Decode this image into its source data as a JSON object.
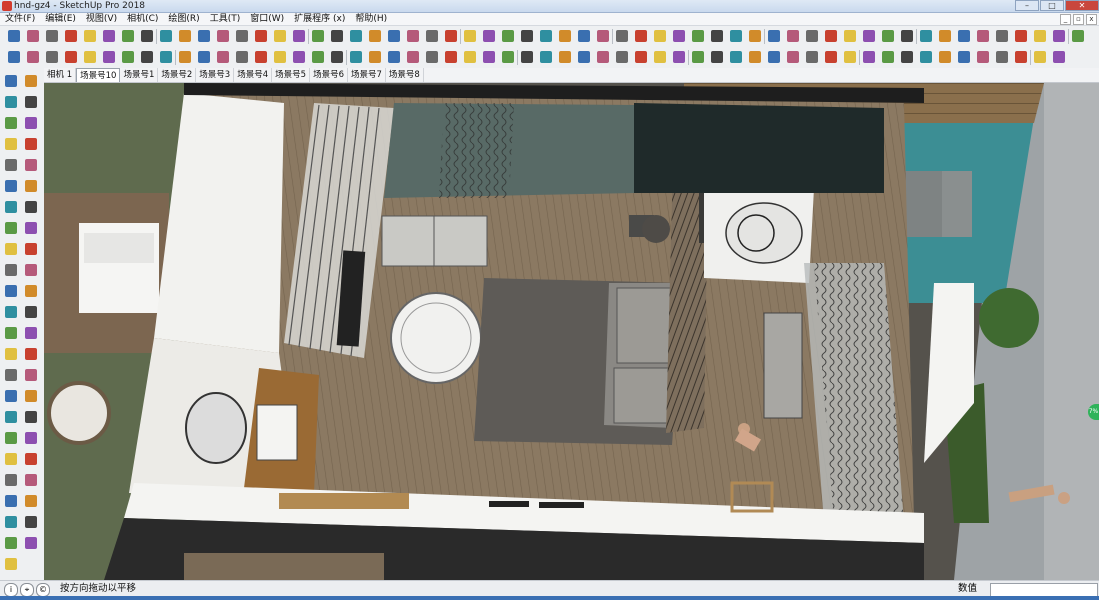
{
  "window": {
    "title": "hnd-gz4 - SketchUp Pro 2018",
    "minimize": "–",
    "maximize": "□",
    "close": "✕"
  },
  "menu": {
    "items": [
      "文件(F)",
      "编辑(E)",
      "视图(V)",
      "相机(C)",
      "绘图(R)",
      "工具(T)",
      "窗口(W)",
      "扩展程序 (x)",
      "帮助(H)"
    ]
  },
  "scenes": {
    "tabs": [
      "相机 1",
      "场景号10",
      "场景号1",
      "场景号2",
      "场景号3",
      "场景号4",
      "场景号5",
      "场景号6",
      "场景号7",
      "场景号8"
    ],
    "active_index": 1
  },
  "statusbar": {
    "message": "按方向拖动以平移",
    "value_label": "数值",
    "value": ""
  },
  "badge": {
    "text": "7%"
  },
  "icons": {
    "toolbar_row1": [
      "select-icon",
      "eraser-icon",
      "line-icon",
      "arc-icon",
      "shape-icon",
      "push-pull-icon",
      "move-icon",
      "rotate-icon",
      "scale-icon",
      "offset-icon",
      "tape-measure-icon",
      "text-icon",
      "axes-icon",
      "paint-bucket-icon",
      "orbit-icon",
      "pan-icon",
      "zoom-icon",
      "zoom-extents-icon",
      "component-icon",
      "warehouse-icon",
      "ruby-icon",
      "isometric-icon",
      "top-view-icon",
      "front-view-icon",
      "right-view-icon",
      "back-view-icon",
      "left-view-icon",
      "xray-icon",
      "wireframe-icon",
      "hidden-line-icon",
      "shaded-icon",
      "textured-icon",
      "monochrome-icon",
      "follow-me-icon",
      "section-icon",
      "dimension-icon",
      "protractor-icon",
      "3d-text-icon",
      "position-camera-icon",
      "walk-icon",
      "look-around-icon",
      "sandbox-icon",
      "shadow-icon",
      "fog-icon",
      "match-photo-icon",
      "home-icon",
      "house-icon",
      "layers-icon",
      "styles-icon",
      "geo-icon",
      "materials-icon",
      "outliner-icon",
      "scene-icon",
      "entity-info-icon",
      "soften-icon",
      "settings-icon",
      "help-icon"
    ],
    "toolbar_row2": [
      "select-icon",
      "pencil-icon",
      "arc-icon",
      "freehand-icon",
      "rectangle-icon",
      "circle-icon",
      "polygon-icon",
      "pie-icon",
      "offset-icon",
      "follow-me-icon",
      "intersect-icon",
      "union-icon",
      "subtract-icon",
      "trim-icon",
      "split-icon",
      "outer-shell-icon",
      "flip-icon",
      "mirror-icon",
      "array-icon",
      "align-icon",
      "weld-icon",
      "chamfer-icon",
      "fillet-icon",
      "extrude-icon",
      "loft-icon",
      "sweep-icon",
      "curve-icon",
      "drape-icon",
      "stamp-icon",
      "smoove-icon",
      "add-detail-icon",
      "flip-edge-icon",
      "contours-icon",
      "from-scratch-icon",
      "terrain-icon",
      "door-icon",
      "window-icon",
      "stair-icon",
      "roof-icon",
      "wall-icon",
      "column-icon",
      "beam-icon",
      "slab-icon",
      "railing-icon",
      "furniture-icon",
      "lamp-icon",
      "plant-icon",
      "people-icon",
      "car-icon",
      "grass-icon",
      "stacked-icon",
      "export-icon",
      "render-icon",
      "light-icon",
      "camera-icon",
      "close-icon"
    ],
    "left_toolbar": [
      "select-icon",
      "make-component-icon",
      "paint-icon",
      "eraser-icon",
      "rectangle-icon",
      "line-icon",
      "circle-icon",
      "arc-icon",
      "polygon-icon",
      "freehand-icon",
      "move-icon",
      "push-pull-icon",
      "rotate-icon",
      "follow-me-icon",
      "scale-icon",
      "offset-icon",
      "tape-icon",
      "dimension-icon",
      "protractor-icon",
      "text-icon",
      "axes-icon",
      "3d-text-icon",
      "orbit-icon",
      "pan-icon",
      "zoom-icon",
      "zoom-window-icon",
      "previous-view-icon",
      "position-camera-icon",
      "walk-icon",
      "look-around-icon",
      "section-icon",
      "sandbox-icon",
      "outliner-icon",
      "styles-icon",
      "materials-icon",
      "layers-icon",
      "scene-icon",
      "shadows-icon",
      "fog-icon",
      "soften-icon",
      "geo-location-icon",
      "warehouse-icon",
      "extension-icon",
      "ruby-console-icon",
      "sketch-icon",
      "photo-icon",
      "paint-can-icon"
    ],
    "status_icons": [
      "info-icon",
      "geo-icon",
      "credit-icon"
    ]
  },
  "colors": {
    "title_close": "#c9473d",
    "accent": "#2b5ea8",
    "badge": "#2fb35a",
    "floor": "#8a7660",
    "water": "#3f8f93",
    "wall": "#f2f2ef"
  }
}
